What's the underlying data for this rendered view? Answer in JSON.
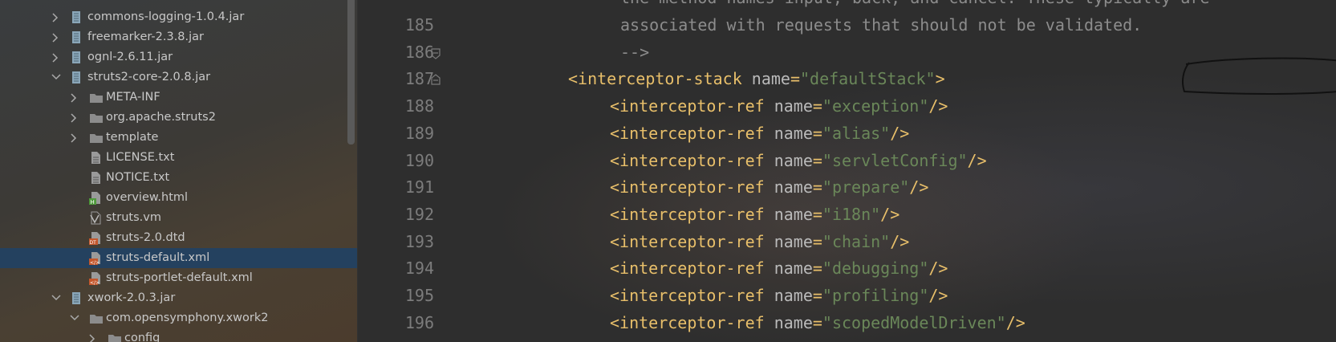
{
  "tree": {
    "items": [
      {
        "label": "commons-logging-1.0.4.jar",
        "icon": "jar-icon",
        "expanded": false
      },
      {
        "label": "freemarker-2.3.8.jar",
        "icon": "jar-icon",
        "expanded": false
      },
      {
        "label": "ognl-2.6.11.jar",
        "icon": "jar-icon",
        "expanded": false
      },
      {
        "label": "struts2-core-2.0.8.jar",
        "icon": "jar-icon",
        "expanded": true
      },
      {
        "label": "META-INF",
        "icon": "folder-icon",
        "expanded": false
      },
      {
        "label": "org.apache.struts2",
        "icon": "folder-icon",
        "expanded": false
      },
      {
        "label": "template",
        "icon": "folder-icon",
        "expanded": false
      },
      {
        "label": "LICENSE.txt",
        "icon": "text-file-icon"
      },
      {
        "label": "NOTICE.txt",
        "icon": "text-file-icon"
      },
      {
        "label": "overview.html",
        "icon": "html-file-icon"
      },
      {
        "label": "struts.vm",
        "icon": "velocity-file-icon"
      },
      {
        "label": "struts-2.0.dtd",
        "icon": "dtd-file-icon"
      },
      {
        "label": "struts-default.xml",
        "icon": "xml-file-icon",
        "selected": true
      },
      {
        "label": "struts-portlet-default.xml",
        "icon": "xml-file-icon"
      },
      {
        "label": "xwork-2.0.3.jar",
        "icon": "jar-icon",
        "expanded": true
      },
      {
        "label": "com.opensymphony.xwork2",
        "icon": "folder-icon",
        "expanded": true
      },
      {
        "label": "config",
        "icon": "folder-icon",
        "expanded": false
      }
    ]
  },
  "editor": {
    "line_numbers": [
      "185",
      "186",
      "187",
      "188",
      "189",
      "190",
      "191",
      "192",
      "193",
      "194",
      "195",
      "196"
    ],
    "comment_line_1": "the method names input, back, and cancel. These typically are",
    "comment_line_2": "associated with requests that should not be validated.",
    "comment_end": "-->",
    "stack": {
      "tag": "<interceptor-stack",
      "attr": "name",
      "value": "defaultStack",
      "close": ">"
    },
    "ref_tag": "<interceptor-ref",
    "ref_attr": "name",
    "ref_close": "/>",
    "refs": [
      "exception",
      "alias",
      "servletConfig",
      "prepare",
      "i18n",
      "chain",
      "debugging",
      "profiling",
      "scopedModelDriven"
    ]
  },
  "colors": {
    "tag": "#e8bf6a",
    "attribute": "#bababa",
    "value": "#6a8759",
    "selection": "#24415f"
  }
}
